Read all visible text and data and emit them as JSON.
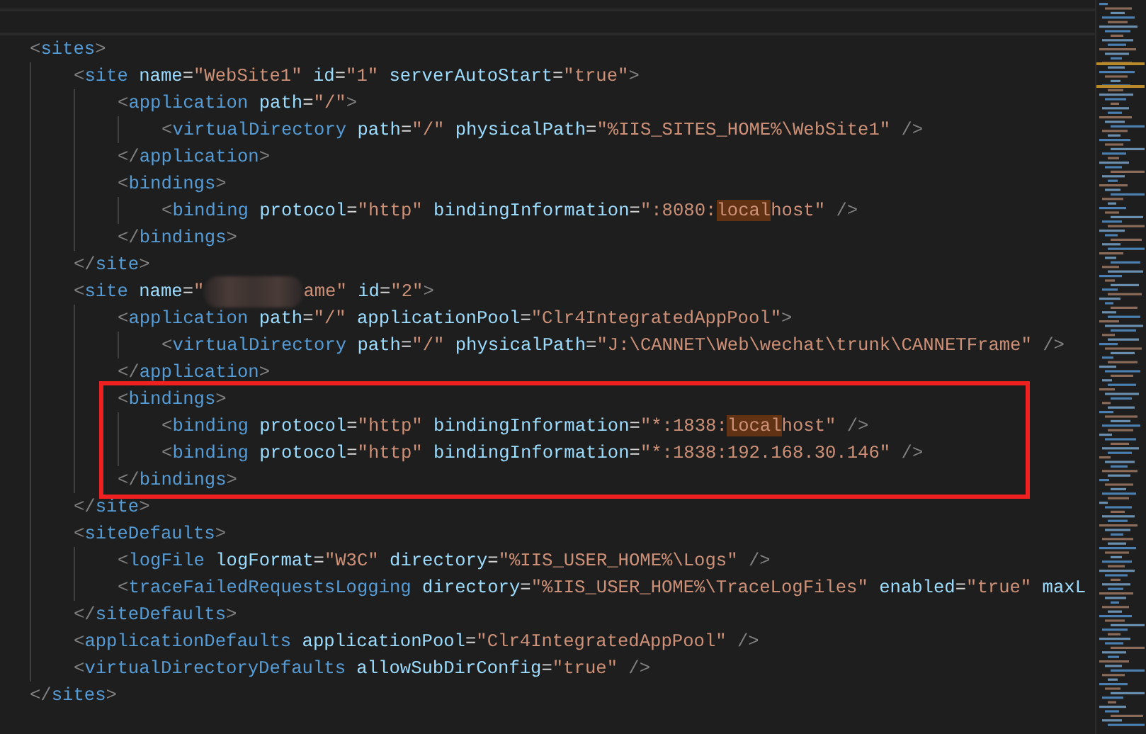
{
  "lines": [
    {
      "boxed": false,
      "tokens": [
        {
          "kind": "b",
          "text": "<"
        },
        {
          "kind": "tag",
          "text": "sites"
        },
        {
          "kind": "b",
          "text": ">"
        }
      ],
      "children": [
        {
          "boxed": false,
          "tokens": [
            {
              "kind": "b",
              "text": "<"
            },
            {
              "kind": "tag",
              "text": "site"
            },
            {
              "kind": "attr",
              "text": " name"
            },
            {
              "kind": "eq",
              "text": "="
            },
            {
              "kind": "str",
              "text": "\"WebSite1\""
            },
            {
              "kind": "attr",
              "text": " id"
            },
            {
              "kind": "eq",
              "text": "="
            },
            {
              "kind": "str",
              "text": "\"1\""
            },
            {
              "kind": "attr",
              "text": " serverAutoStart"
            },
            {
              "kind": "eq",
              "text": "="
            },
            {
              "kind": "str",
              "text": "\"true\""
            },
            {
              "kind": "b",
              "text": ">"
            }
          ],
          "children": [
            {
              "boxed": false,
              "tokens": [
                {
                  "kind": "b",
                  "text": "<"
                },
                {
                  "kind": "tag",
                  "text": "application"
                },
                {
                  "kind": "attr",
                  "text": " path"
                },
                {
                  "kind": "eq",
                  "text": "="
                },
                {
                  "kind": "str",
                  "text": "\"/\""
                },
                {
                  "kind": "b",
                  "text": ">"
                }
              ],
              "children": [
                {
                  "boxed": false,
                  "tokens": [
                    {
                      "kind": "b",
                      "text": "<"
                    },
                    {
                      "kind": "tag",
                      "text": "virtualDirectory"
                    },
                    {
                      "kind": "attr",
                      "text": " path"
                    },
                    {
                      "kind": "eq",
                      "text": "="
                    },
                    {
                      "kind": "str",
                      "text": "\"/\""
                    },
                    {
                      "kind": "attr",
                      "text": " physicalPath"
                    },
                    {
                      "kind": "eq",
                      "text": "="
                    },
                    {
                      "kind": "str",
                      "text": "\"%IIS_SITES_HOME%\\WebSite1\""
                    },
                    {
                      "kind": "b",
                      "text": " />"
                    }
                  ]
                }
              ]
            },
            {
              "boxed": false,
              "tokens": [
                {
                  "kind": "b",
                  "text": "</"
                },
                {
                  "kind": "tag",
                  "text": "application"
                },
                {
                  "kind": "b",
                  "text": ">"
                }
              ]
            },
            {
              "boxed": false,
              "tokens": [
                {
                  "kind": "b",
                  "text": "<"
                },
                {
                  "kind": "tag",
                  "text": "bindings"
                },
                {
                  "kind": "b",
                  "text": ">"
                }
              ],
              "children": [
                {
                  "boxed": false,
                  "tokens": [
                    {
                      "kind": "b",
                      "text": "<"
                    },
                    {
                      "kind": "tag",
                      "text": "binding"
                    },
                    {
                      "kind": "attr",
                      "text": " protocol"
                    },
                    {
                      "kind": "eq",
                      "text": "="
                    },
                    {
                      "kind": "str",
                      "text": "\"http\""
                    },
                    {
                      "kind": "attr",
                      "text": " bindingInformation"
                    },
                    {
                      "kind": "eq",
                      "text": "="
                    },
                    {
                      "kind": "str",
                      "text": "\":8080:"
                    },
                    {
                      "kind": "hl",
                      "text": "local"
                    },
                    {
                      "kind": "str",
                      "text": "host\""
                    },
                    {
                      "kind": "b",
                      "text": " />"
                    }
                  ]
                }
              ]
            },
            {
              "boxed": false,
              "tokens": [
                {
                  "kind": "b",
                  "text": "</"
                },
                {
                  "kind": "tag",
                  "text": "bindings"
                },
                {
                  "kind": "b",
                  "text": ">"
                }
              ]
            }
          ]
        },
        {
          "boxed": false,
          "tokens": [
            {
              "kind": "b",
              "text": "</"
            },
            {
              "kind": "tag",
              "text": "site"
            },
            {
              "kind": "b",
              "text": ">"
            }
          ]
        },
        {
          "boxed": false,
          "tokens": [
            {
              "kind": "b",
              "text": "<"
            },
            {
              "kind": "tag",
              "text": "site"
            },
            {
              "kind": "attr",
              "text": " name"
            },
            {
              "kind": "eq",
              "text": "="
            },
            {
              "kind": "str",
              "text": "\""
            },
            {
              "kind": "redacted"
            },
            {
              "kind": "str",
              "text": "ame\""
            },
            {
              "kind": "attr",
              "text": " id"
            },
            {
              "kind": "eq",
              "text": "="
            },
            {
              "kind": "str",
              "text": "\"2\""
            },
            {
              "kind": "b",
              "text": ">"
            }
          ],
          "children": [
            {
              "boxed": false,
              "tokens": [
                {
                  "kind": "b",
                  "text": "<"
                },
                {
                  "kind": "tag",
                  "text": "application"
                },
                {
                  "kind": "attr",
                  "text": " path"
                },
                {
                  "kind": "eq",
                  "text": "="
                },
                {
                  "kind": "str",
                  "text": "\"/\""
                },
                {
                  "kind": "attr",
                  "text": " applicationPool"
                },
                {
                  "kind": "eq",
                  "text": "="
                },
                {
                  "kind": "str",
                  "text": "\"Clr4IntegratedAppPool\""
                },
                {
                  "kind": "b",
                  "text": ">"
                }
              ],
              "children": [
                {
                  "boxed": false,
                  "tokens": [
                    {
                      "kind": "b",
                      "text": "<"
                    },
                    {
                      "kind": "tag",
                      "text": "virtualDirectory"
                    },
                    {
                      "kind": "attr",
                      "text": " path"
                    },
                    {
                      "kind": "eq",
                      "text": "="
                    },
                    {
                      "kind": "str",
                      "text": "\"/\""
                    },
                    {
                      "kind": "attr",
                      "text": " physicalPath"
                    },
                    {
                      "kind": "eq",
                      "text": "="
                    },
                    {
                      "kind": "str",
                      "text": "\"J:\\CANNET\\Web\\wechat\\trunk\\CANNETFrame\""
                    },
                    {
                      "kind": "b",
                      "text": " />"
                    }
                  ]
                }
              ]
            },
            {
              "boxed": false,
              "tokens": [
                {
                  "kind": "b",
                  "text": "</"
                },
                {
                  "kind": "tag",
                  "text": "application"
                },
                {
                  "kind": "b",
                  "text": ">"
                }
              ]
            },
            {
              "boxed": true,
              "tokens": [
                {
                  "kind": "b",
                  "text": "<"
                },
                {
                  "kind": "tag",
                  "text": "bindings"
                },
                {
                  "kind": "b",
                  "text": ">"
                }
              ],
              "children": [
                {
                  "boxed": false,
                  "tokens": [
                    {
                      "kind": "b",
                      "text": "<"
                    },
                    {
                      "kind": "tag",
                      "text": "binding"
                    },
                    {
                      "kind": "attr",
                      "text": " protocol"
                    },
                    {
                      "kind": "eq",
                      "text": "="
                    },
                    {
                      "kind": "str",
                      "text": "\"http\""
                    },
                    {
                      "kind": "attr",
                      "text": " bindingInformation"
                    },
                    {
                      "kind": "eq",
                      "text": "="
                    },
                    {
                      "kind": "str",
                      "text": "\"*:1838:"
                    },
                    {
                      "kind": "hl",
                      "text": "local"
                    },
                    {
                      "kind": "str",
                      "text": "host\""
                    },
                    {
                      "kind": "b",
                      "text": " />"
                    }
                  ]
                },
                {
                  "boxed": false,
                  "tokens": [
                    {
                      "kind": "b",
                      "text": "<"
                    },
                    {
                      "kind": "tag",
                      "text": "binding"
                    },
                    {
                      "kind": "attr",
                      "text": " protocol"
                    },
                    {
                      "kind": "eq",
                      "text": "="
                    },
                    {
                      "kind": "str",
                      "text": "\"http\""
                    },
                    {
                      "kind": "attr",
                      "text": " bindingInformation"
                    },
                    {
                      "kind": "eq",
                      "text": "="
                    },
                    {
                      "kind": "str",
                      "text": "\"*:1838:192.168.30.146\""
                    },
                    {
                      "kind": "b",
                      "text": " />"
                    }
                  ]
                }
              ]
            },
            {
              "boxed": true,
              "tokens": [
                {
                  "kind": "b",
                  "text": "</"
                },
                {
                  "kind": "tag",
                  "text": "bindings"
                },
                {
                  "kind": "b",
                  "text": ">"
                }
              ]
            }
          ]
        },
        {
          "boxed": false,
          "tokens": [
            {
              "kind": "b",
              "text": "</"
            },
            {
              "kind": "tag",
              "text": "site"
            },
            {
              "kind": "b",
              "text": ">"
            }
          ]
        },
        {
          "boxed": false,
          "tokens": [
            {
              "kind": "b",
              "text": "<"
            },
            {
              "kind": "tag",
              "text": "siteDefaults"
            },
            {
              "kind": "b",
              "text": ">"
            }
          ],
          "children": [
            {
              "boxed": false,
              "tokens": [
                {
                  "kind": "b",
                  "text": "<"
                },
                {
                  "kind": "tag",
                  "text": "logFile"
                },
                {
                  "kind": "attr",
                  "text": " logFormat"
                },
                {
                  "kind": "eq",
                  "text": "="
                },
                {
                  "kind": "str",
                  "text": "\"W3C\""
                },
                {
                  "kind": "attr",
                  "text": " directory"
                },
                {
                  "kind": "eq",
                  "text": "="
                },
                {
                  "kind": "str",
                  "text": "\"%IIS_USER_HOME%\\Logs\""
                },
                {
                  "kind": "b",
                  "text": " />"
                }
              ]
            },
            {
              "boxed": false,
              "tokens": [
                {
                  "kind": "b",
                  "text": "<"
                },
                {
                  "kind": "tag",
                  "text": "traceFailedRequestsLogging"
                },
                {
                  "kind": "attr",
                  "text": " directory"
                },
                {
                  "kind": "eq",
                  "text": "="
                },
                {
                  "kind": "str",
                  "text": "\"%IIS_USER_HOME%\\TraceLogFiles\""
                },
                {
                  "kind": "attr",
                  "text": " enabled"
                },
                {
                  "kind": "eq",
                  "text": "="
                },
                {
                  "kind": "str",
                  "text": "\"true\""
                },
                {
                  "kind": "attr",
                  "text": " maxL"
                }
              ]
            }
          ]
        },
        {
          "boxed": false,
          "tokens": [
            {
              "kind": "b",
              "text": "</"
            },
            {
              "kind": "tag",
              "text": "siteDefaults"
            },
            {
              "kind": "b",
              "text": ">"
            }
          ]
        },
        {
          "boxed": false,
          "tokens": [
            {
              "kind": "b",
              "text": "<"
            },
            {
              "kind": "tag",
              "text": "applicationDefaults"
            },
            {
              "kind": "attr",
              "text": " applicationPool"
            },
            {
              "kind": "eq",
              "text": "="
            },
            {
              "kind": "str",
              "text": "\"Clr4IntegratedAppPool\""
            },
            {
              "kind": "b",
              "text": " />"
            }
          ]
        },
        {
          "boxed": false,
          "tokens": [
            {
              "kind": "b",
              "text": "<"
            },
            {
              "kind": "tag",
              "text": "virtualDirectoryDefaults"
            },
            {
              "kind": "attr",
              "text": " allowSubDirConfig"
            },
            {
              "kind": "eq",
              "text": "="
            },
            {
              "kind": "str",
              "text": "\"true\""
            },
            {
              "kind": "b",
              "text": " />"
            }
          ]
        }
      ]
    },
    {
      "boxed": false,
      "tokens": [
        {
          "kind": "b",
          "text": "</"
        },
        {
          "kind": "tag",
          "text": "sites"
        },
        {
          "kind": "b",
          "text": ">"
        }
      ]
    }
  ]
}
